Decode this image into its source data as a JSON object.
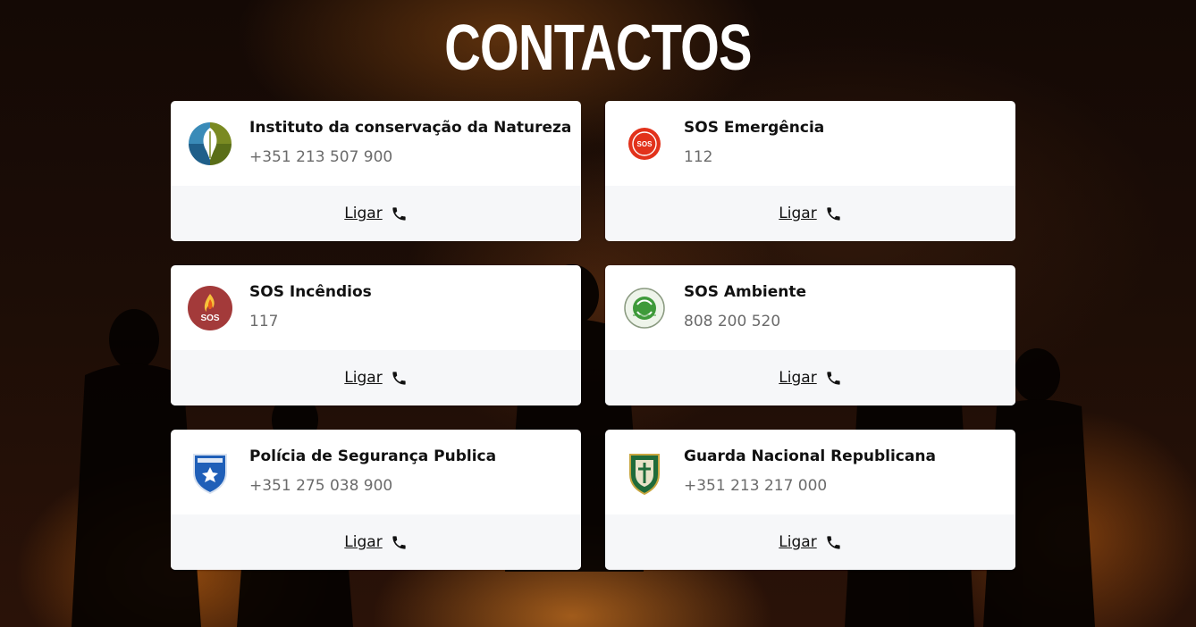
{
  "page": {
    "title": "CONTACTOS"
  },
  "contacts": [
    {
      "name": "Instituto da conservação da Natureza",
      "phone": "+351 213 507 900",
      "action": "Ligar",
      "logo": "icnf-logo"
    },
    {
      "name": "SOS Emergência",
      "phone": "112",
      "action": "Ligar",
      "logo": "sos-emergencia-logo"
    },
    {
      "name": "SOS Incêndios",
      "phone": "117",
      "action": "Ligar",
      "logo": "sos-incendios-logo"
    },
    {
      "name": "SOS Ambiente",
      "phone": "808 200 520",
      "action": "Ligar",
      "logo": "sos-ambiente-logo"
    },
    {
      "name": "Polícia de Segurança Publica",
      "phone": "+351 275 038 900",
      "action": "Ligar",
      "logo": "psp-logo"
    },
    {
      "name": "Guarda Nacional Republicana",
      "phone": "+351 213 217 000",
      "action": "Ligar",
      "logo": "gnr-logo"
    }
  ],
  "icons": {
    "call": "phone-icon"
  },
  "colors": {
    "card_bg": "#ffffff",
    "card_footer_bg": "#f6f7f9",
    "phone_text": "#6b6b6b",
    "title_text": "#ffffff"
  }
}
